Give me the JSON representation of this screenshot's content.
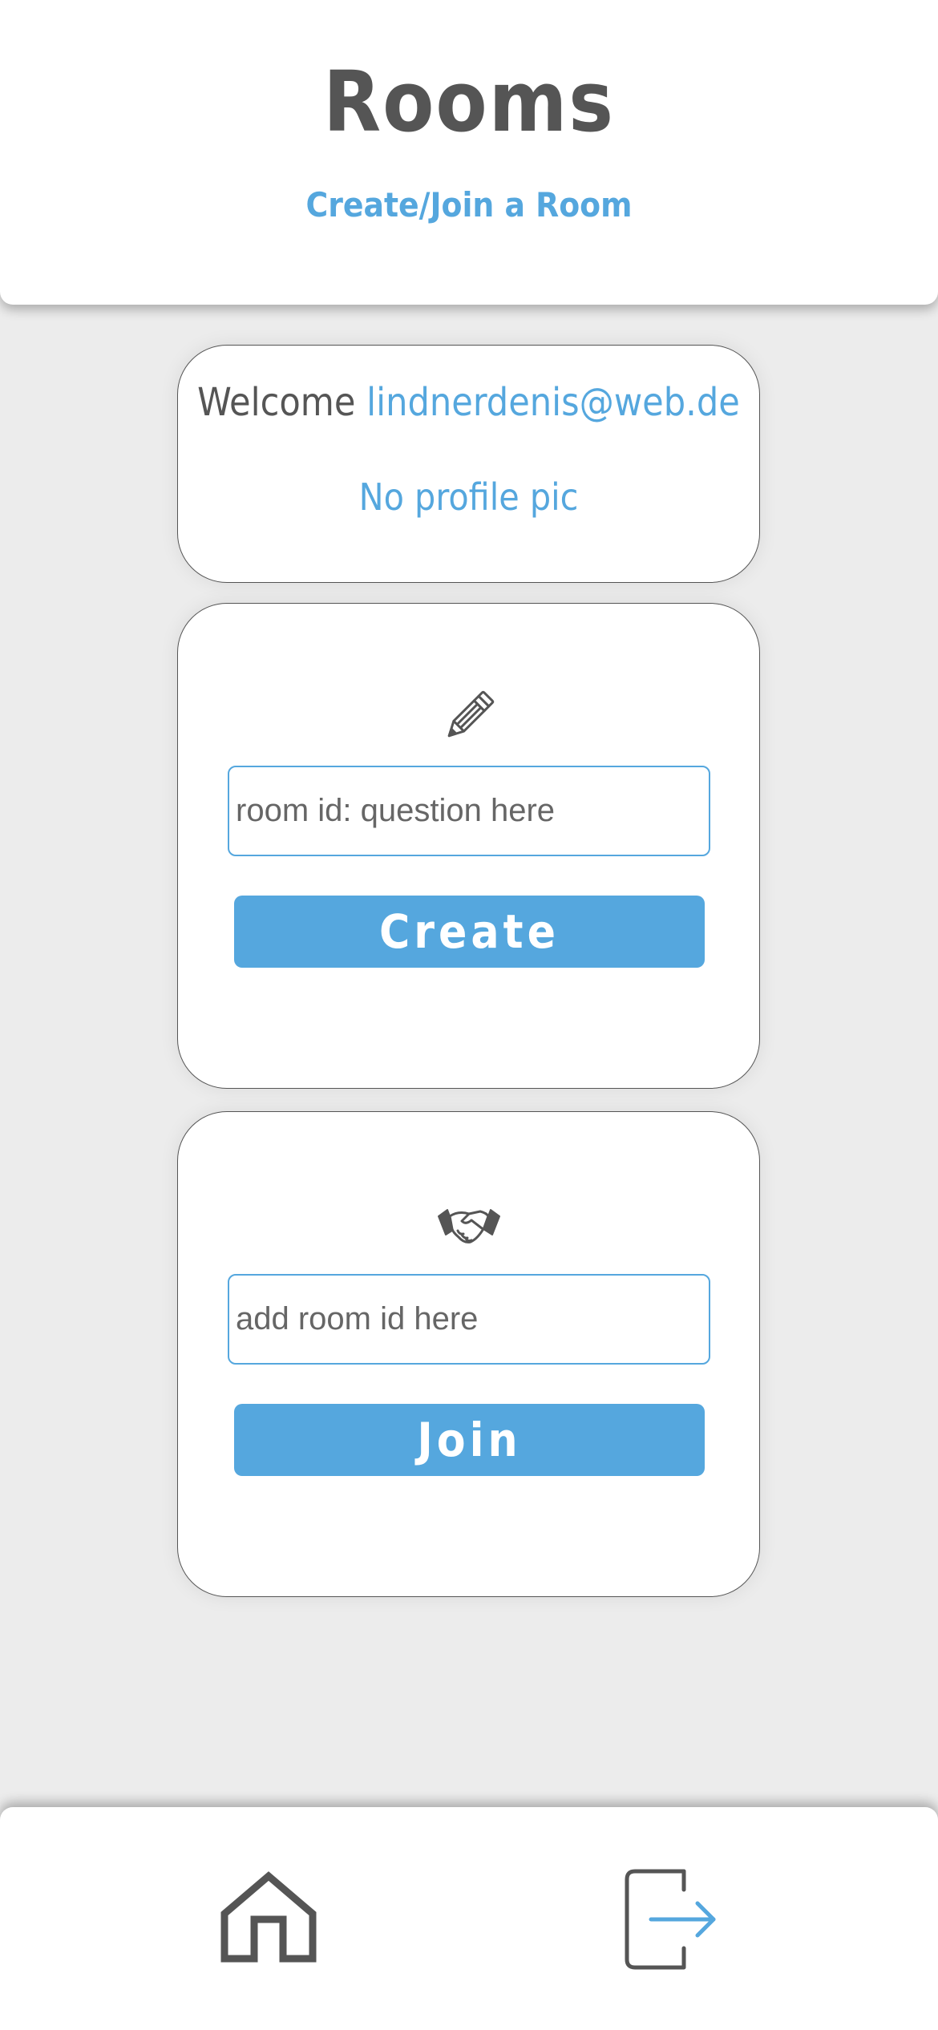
{
  "header": {
    "title": "Rooms",
    "subtitle": "Create/Join a Room"
  },
  "welcome_card": {
    "label": "Welcome",
    "email": "lindnerdenis@web.de",
    "profile_text": "No profile pic"
  },
  "create_card": {
    "icon": "pencil-icon",
    "input_placeholder": "room id: question here",
    "input_value": "",
    "button_label": "Create"
  },
  "join_card": {
    "icon": "handshake-icon",
    "input_placeholder": "add room id here",
    "input_value": "",
    "button_label": "Join"
  },
  "bottom_nav": {
    "items": [
      {
        "icon": "home-icon"
      },
      {
        "icon": "logout-icon"
      }
    ]
  },
  "colors": {
    "accent": "#55a7de",
    "text": "#555555",
    "background": "#ececec",
    "surface": "#ffffff"
  }
}
